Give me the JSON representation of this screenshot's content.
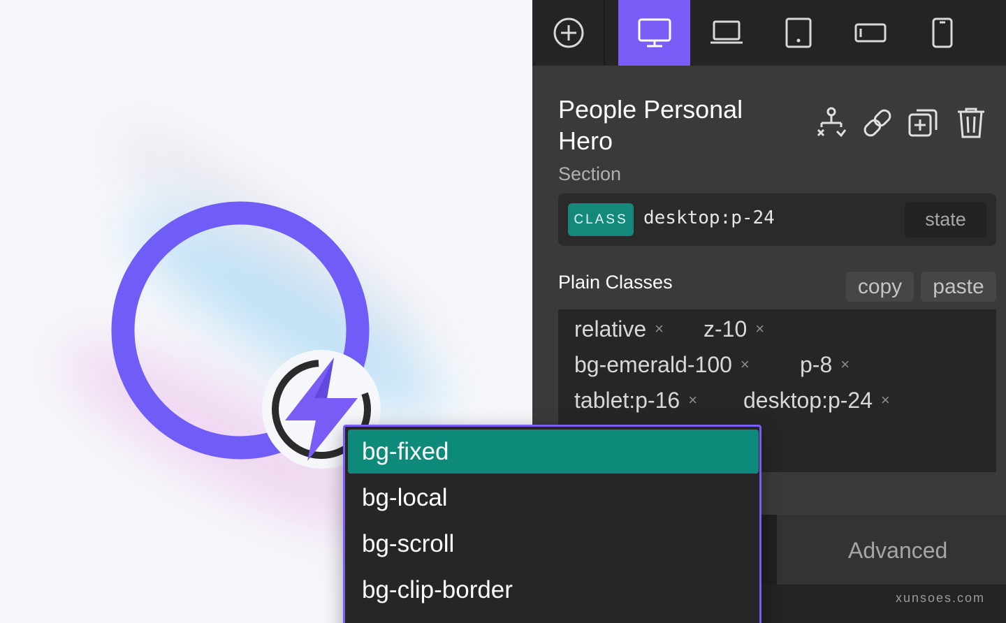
{
  "toolbar": {
    "add_icon": "plus-circle-icon",
    "devices": [
      {
        "name": "desktop-icon",
        "active": true
      },
      {
        "name": "laptop-icon",
        "active": false
      },
      {
        "name": "tablet-icon",
        "active": false
      },
      {
        "name": "tablet-landscape-icon",
        "active": false
      },
      {
        "name": "mobile-icon",
        "active": false
      }
    ],
    "accent_color": "#7b5cf6"
  },
  "element": {
    "title": "People Personal Hero",
    "type": "Section",
    "actions": [
      "hierarchy-icon",
      "link-icon",
      "duplicate-icon",
      "trash-icon"
    ]
  },
  "class_selector": {
    "badge": "CLASS",
    "value": "desktop:p-24",
    "state_label": "state",
    "badge_color": "#14897a"
  },
  "plain_classes": {
    "label": "Plain Classes",
    "copy_label": "copy",
    "paste_label": "paste",
    "remove_symbol": "×",
    "items": [
      "relative",
      "z-10",
      "bg-emerald-100",
      "p-8",
      "tablet:p-16",
      "desktop:p-24"
    ]
  },
  "advanced": {
    "label": "Advanced"
  },
  "suggestions": {
    "items": [
      "bg-fixed",
      "bg-local",
      "bg-scroll",
      "bg-clip-border"
    ],
    "selected_index": 0,
    "highlight_color": "#0e8a7b"
  },
  "watermark": "xunsoes.com"
}
